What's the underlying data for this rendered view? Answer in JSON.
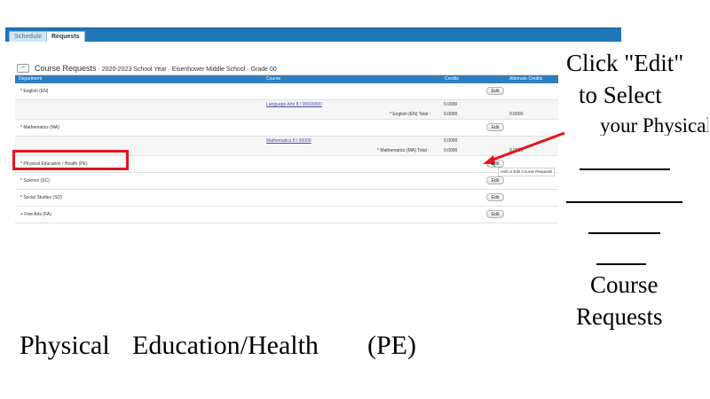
{
  "tabs": [
    {
      "label": "Schedule",
      "active": false
    },
    {
      "label": "Requests",
      "active": true
    }
  ],
  "panel": {
    "collapse_icon": "minus-icon",
    "title": "Course Requests",
    "subtitle": "· 2020-2023 School Year · Eisenhower Middle School · Grade 00",
    "columns": [
      "Department",
      "Course",
      "Credits",
      "Alternate Credits"
    ]
  },
  "categories": [
    {
      "label": "* English (EN)",
      "edit": "Edit",
      "course": "Language Arts 8 / 00000000",
      "course_credits": "0.0000",
      "total_label": "* English (EN) Total :",
      "total": "0.0000",
      "alt_total": "0.0000"
    },
    {
      "label": "* Mathematics (MA)",
      "edit": "Edit",
      "course": "Mathematics 8 / 00000",
      "course_credits": "0.0000",
      "total_label": "* Mathematics (MA) Total :",
      "total": "0.0000",
      "alt_total": "0.0000"
    },
    {
      "label": "* Physical Education / Health (PE)",
      "edit": "Edit",
      "tooltip": "Add or Edit Course Requests"
    },
    {
      "label": "* Science (SC)",
      "edit": "Edit"
    },
    {
      "label": "* Social Studies (SO)",
      "edit": "Edit"
    },
    {
      "label": "+ Fine Arts (FA)",
      "edit": "Edit"
    }
  ],
  "instructions": {
    "line1": "Click \"Edit\"",
    "line2": "to  Select",
    "line3": "your Physical Education/Health",
    "line4": "Course",
    "line5": "Requests"
  },
  "footer": {
    "part1": "Physical",
    "part2": "Education/Health",
    "part3": "(PE)"
  },
  "colors": {
    "highlight": "#e8141c",
    "header_blue": "#2f7dbd",
    "tabbar_blue": "#1f77b8"
  }
}
